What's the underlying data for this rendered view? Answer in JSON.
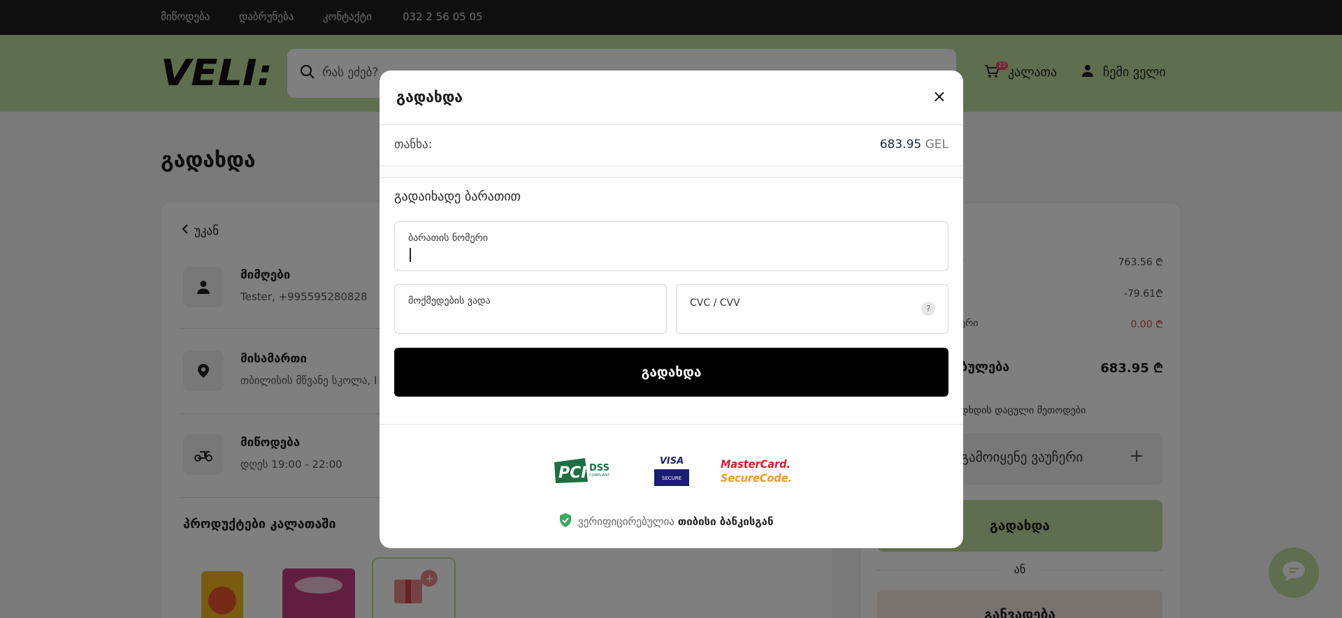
{
  "topbar": {
    "links": [
      "მიწოდება",
      "დაბრუნება",
      "კონტაქტი",
      "032 2 56 05 05"
    ]
  },
  "header": {
    "logo": "VELI:",
    "search_placeholder": "რას ეძებ?",
    "cart_label": "კალათა",
    "cart_count": "22",
    "account_label": "ჩემი ველი"
  },
  "page": {
    "title": "გადახდა",
    "back_label": "უკან",
    "receiver": {
      "title": "მიმღები",
      "value": "Tester, +995595280828"
    },
    "address": {
      "title": "მისამართი",
      "value": "თბილისის მწვანე სკოლა, I"
    },
    "delivery": {
      "title": "მიწოდება",
      "value": "დღეს  19:00 - 22:00"
    },
    "products_title": "პროდუქტები კალათაში"
  },
  "summary": {
    "row1_label": ")",
    "row1_value": "763.56 ₾",
    "row2_value": "-79.61₾",
    "row3_label": "ერი",
    "row3_value": "0.00 ₾",
    "total_label": "ბულება",
    "total_value": "683.95 ₾",
    "methods_text": "დხდის დაცული მეთოდები",
    "voucher_label": "გამოიყენე ვაუჩერი",
    "voucher_plus": "+",
    "pay_label": "გადახდა",
    "or_label": "ან",
    "bottom_label": "განვადება"
  },
  "modal": {
    "title": "გადახდა",
    "close": "×",
    "amount_label": "თანხა:",
    "amount_value": "683.95",
    "amount_currency": "GEL",
    "subtitle": "გადაიხადე ბარათით",
    "card_number_label": "ბარათის ნომერი",
    "expiry_label": "მოქმედების ვადა",
    "cvc_label": "CVC / CVV",
    "cvc_help": "?",
    "pay_button": "გადახდა",
    "badge_pci_1": "PCI",
    "badge_pci_2": "DSS",
    "badge_pci_3": "COMPLIANT",
    "badge_visa_1": "VISA",
    "badge_visa_2": "SECURE",
    "badge_mc_1": "MasterCard.",
    "badge_mc_2": "SecureCode.",
    "verified_prefix": "ვერიფიცირებულია",
    "verified_bank": "თიბისი ბანკისგან"
  },
  "colors": {
    "header_bg": "#bddc9c",
    "topbar_bg": "#1f1f1f",
    "primary_button": "#000000",
    "accent_green": "#bddc9c",
    "shield_green": "#3aaa5c"
  }
}
